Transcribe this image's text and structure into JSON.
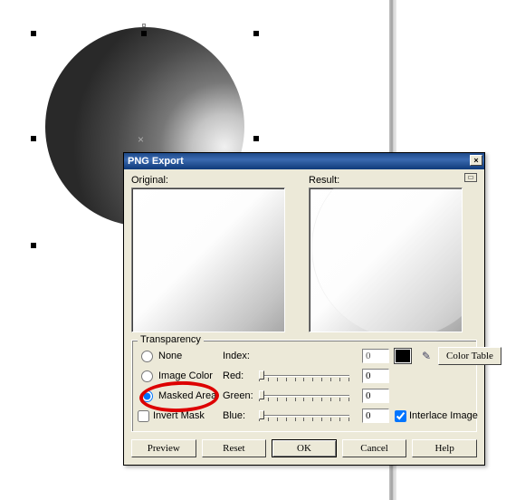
{
  "dialog": {
    "title": "PNG Export",
    "original_label": "Original:",
    "result_label": "Result:"
  },
  "transparency": {
    "legend": "Transparency",
    "none": "None",
    "image_color": "Image Color",
    "masked_area": "Masked Area",
    "invert_mask": "Invert Mask",
    "index_label": "Index:",
    "red_label": "Red:",
    "green_label": "Green:",
    "blue_label": "Blue:",
    "index_value": "0",
    "red_value": "0",
    "green_value": "0",
    "blue_value": "0",
    "color_table": "Color Table",
    "interlace": "Interlace Image"
  },
  "buttons": {
    "preview": "Preview",
    "reset": "Reset",
    "ok": "OK",
    "cancel": "Cancel",
    "help": "Help"
  }
}
